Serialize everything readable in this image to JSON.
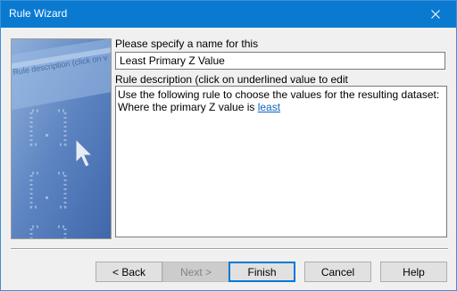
{
  "window": {
    "title": "Rule Wizard"
  },
  "side_image": {
    "caption": "Rule description (click on v"
  },
  "name": {
    "label": "Please specify a name for this",
    "value": "Least Primary Z Value"
  },
  "description": {
    "label": "Rule description (click on underlined value to edit",
    "line1": "Use the following rule to choose the values for the resulting dataset:",
    "line2_prefix": "Where the primary Z value is ",
    "line2_link": "least"
  },
  "buttons": {
    "back": "< Back",
    "next": "Next >",
    "finish": "Finish",
    "cancel": "Cancel",
    "help": "Help"
  },
  "colors": {
    "titlebar": "#0a7ad1",
    "link": "#0b64c0",
    "default_button_border": "#0078d7"
  }
}
